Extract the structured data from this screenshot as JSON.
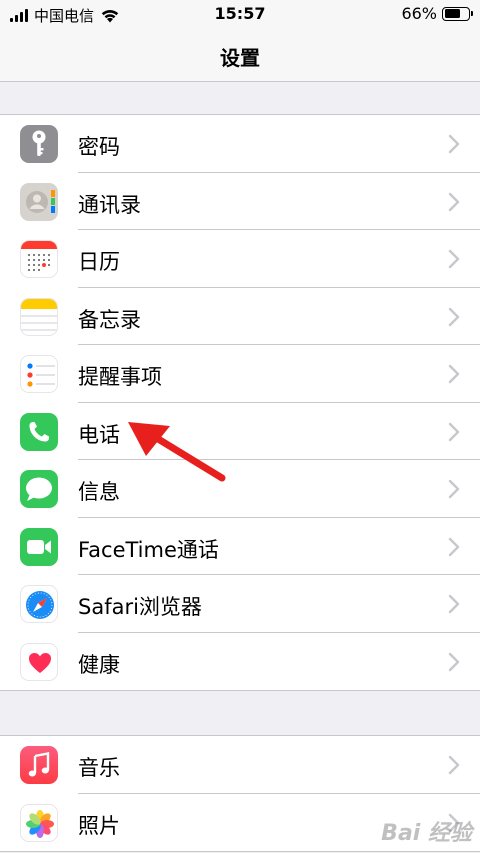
{
  "status_bar": {
    "carrier": "中国电信",
    "time": "15:57",
    "battery_percent": "66%",
    "battery_level": 0.66
  },
  "nav": {
    "title": "设置"
  },
  "groups": [
    {
      "items": [
        {
          "label": "密码",
          "icon": "key-icon",
          "color": "#8e8e93"
        },
        {
          "label": "通讯录",
          "icon": "contacts-icon",
          "color": "#d6d3ce"
        },
        {
          "label": "日历",
          "icon": "calendar-icon",
          "color": "#ff3b30"
        },
        {
          "label": "备忘录",
          "icon": "notes-icon",
          "color": "#ffcc00"
        },
        {
          "label": "提醒事项",
          "icon": "reminders-icon",
          "color": "#ffffff"
        },
        {
          "label": "电话",
          "icon": "phone-icon",
          "color": "#34c759"
        },
        {
          "label": "信息",
          "icon": "messages-icon",
          "color": "#34c759"
        },
        {
          "label": "FaceTime通话",
          "icon": "facetime-icon",
          "color": "#34c759"
        },
        {
          "label": "Safari浏览器",
          "icon": "safari-icon",
          "color": "#1b8cf5"
        },
        {
          "label": "健康",
          "icon": "health-icon",
          "color": "#ff2d55"
        }
      ]
    },
    {
      "items": [
        {
          "label": "音乐",
          "icon": "music-icon",
          "color": "#fc3c44"
        },
        {
          "label": "照片",
          "icon": "photos-icon",
          "color": "#ffffff"
        }
      ]
    }
  ],
  "watermark": "Bai 经验"
}
